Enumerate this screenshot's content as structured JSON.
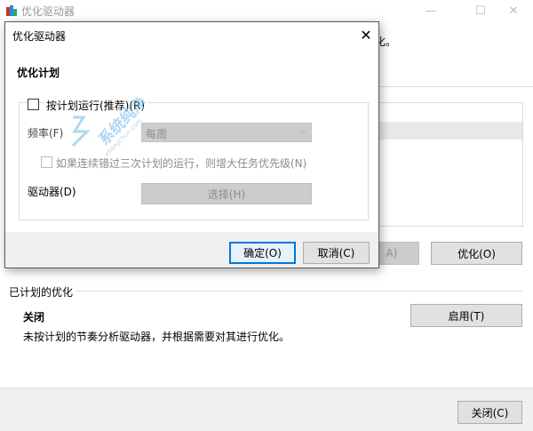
{
  "main_window": {
    "title": "优化驱动器",
    "bg_text_snippet": "化。",
    "buttons": {
      "analyze_partial": "A)",
      "optimize": "优化(O)",
      "enable": "启用(T)",
      "close": "关闭(C)"
    },
    "scheduled": {
      "section_label": "已计划的优化",
      "status": "关闭",
      "description": "未按计划的节奏分析驱动器，并根据需要对其进行优化。"
    }
  },
  "dialog": {
    "title": "优化驱动器",
    "section_heading": "优化计划",
    "run_on_schedule": {
      "label": "按计划运行(推荐)(R)",
      "checked": false
    },
    "frequency": {
      "label": "频率(F)",
      "value": "每周",
      "enabled": false
    },
    "increase_priority": {
      "label": "如果连续错过三次计划的运行，则增大任务优先级(N)",
      "checked": false,
      "enabled": false
    },
    "drives": {
      "label": "驱动器(D)",
      "button_label": "选择(H)",
      "enabled": false
    },
    "buttons": {
      "ok": "确定(O)",
      "cancel": "取消(C)"
    }
  },
  "watermark": {
    "text": "系统纯净",
    "url": "xitongchun.com"
  },
  "colors": {
    "accent": "#0078d7",
    "disabled_text": "#8c8c8c",
    "disabled_bg": "#cccccc"
  }
}
